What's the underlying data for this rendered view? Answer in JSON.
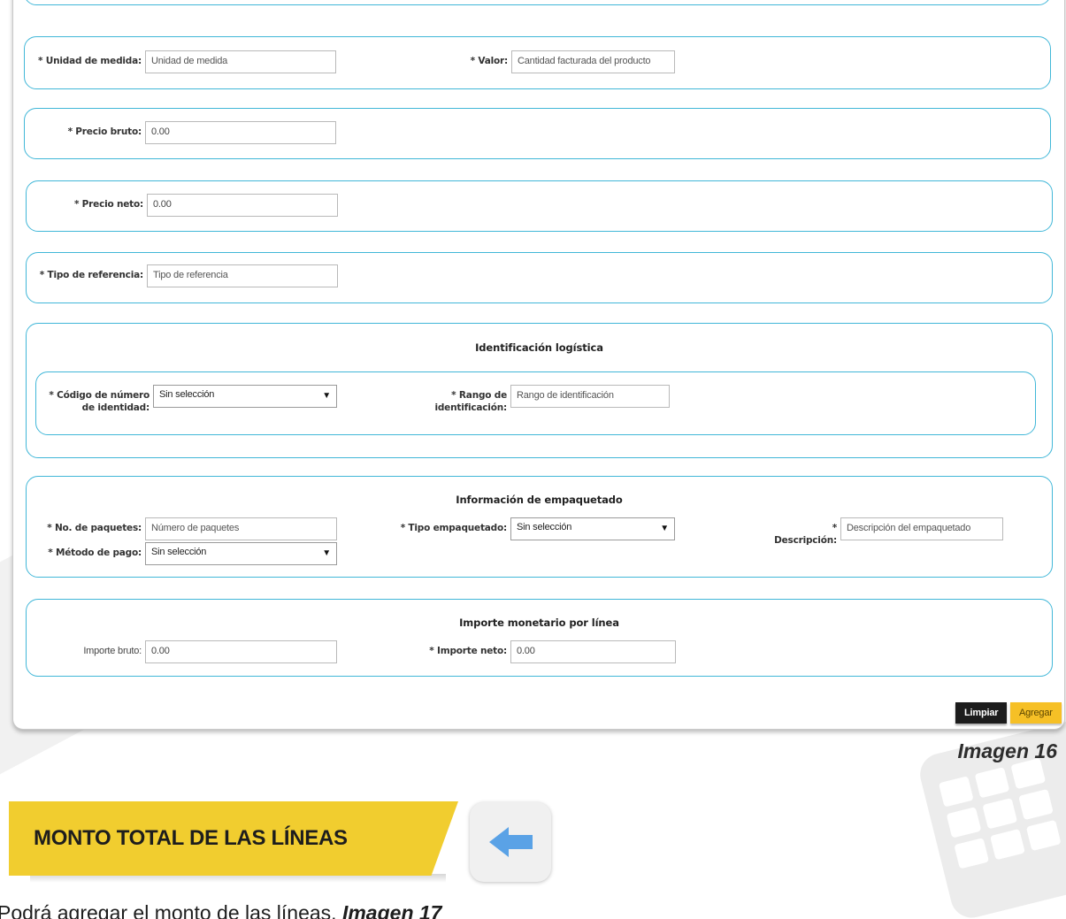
{
  "form": {
    "unidad_medida": {
      "label": "* Unidad de medida:",
      "placeholder": "Unidad de medida"
    },
    "valor": {
      "label": "* Valor:",
      "placeholder": "Cantidad facturada del producto"
    },
    "precio_bruto": {
      "label": "* Precio bruto:",
      "value": "0.00"
    },
    "precio_neto": {
      "label": "* Precio neto:",
      "value": "0.00"
    },
    "tipo_referencia": {
      "label": "* Tipo de referencia:",
      "placeholder": "Tipo de referencia"
    },
    "logistica": {
      "title": "Identificación logística",
      "codigo_label": "* Código de número de identidad:",
      "codigo_value": "Sin selección",
      "rango_label": "* Rango de identificación:",
      "rango_placeholder": "Rango de identificación"
    },
    "empaquetado": {
      "title": "Información de empaquetado",
      "paquetes_label": "* No. de paquetes:",
      "paquetes_placeholder": "Número de paquetes",
      "tipo_label": "* Tipo empaquetado:",
      "tipo_value": "Sin selección",
      "descripcion_label": "* Descripción:",
      "descripcion_placeholder": "Descripción del empaquetado",
      "metodo_label": "* Método de pago:",
      "metodo_value": "Sin selección"
    },
    "importe": {
      "title": "Importe monetario por línea",
      "bruto_label": "Importe bruto:",
      "bruto_value": "0.00",
      "neto_label": "* Importe neto:",
      "neto_value": "0.00"
    },
    "buttons": {
      "clear": "Limpiar",
      "add": "Agregar"
    }
  },
  "caption": "Imagen 16",
  "banner": {
    "title": "MONTO TOTAL DE LAS LÍNEAS",
    "icon": "arrow-left-icon",
    "color": "#f1cd2f",
    "icon_color": "#5aa2e6"
  },
  "footnote": {
    "text": "Podrá agregar el monto de las líneas.",
    "ref": "Imagen 17"
  },
  "colors": {
    "border": "#41b7d8",
    "button_dark": "#1c1c1c",
    "button_yellow": "#f6c026"
  }
}
